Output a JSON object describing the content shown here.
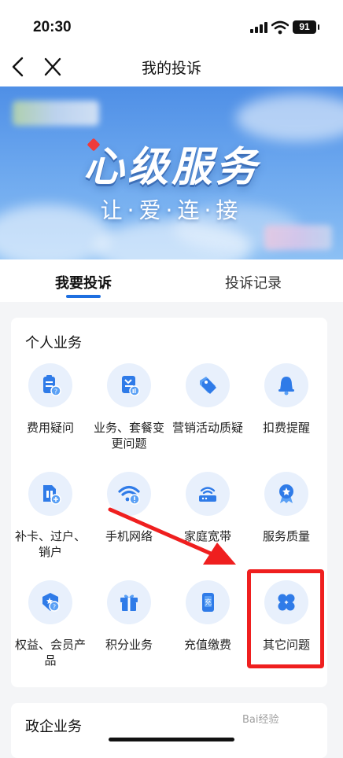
{
  "status_bar": {
    "time": "20:30",
    "battery": "91"
  },
  "nav": {
    "title": "我的投诉"
  },
  "banner": {
    "headline": "心级服务",
    "subline": "让·爱·连·接"
  },
  "tabs": [
    {
      "label": "我要投诉",
      "active": true
    },
    {
      "label": "投诉记录",
      "active": false
    }
  ],
  "personal": {
    "title": "个人业务",
    "items": [
      {
        "label": "费用疑问",
        "icon": "bill-question-icon"
      },
      {
        "label": "业务、套餐变更问题",
        "icon": "package-change-icon"
      },
      {
        "label": "营销活动质疑",
        "icon": "tag-icon"
      },
      {
        "label": "扣费提醒",
        "icon": "bell-icon"
      },
      {
        "label": "补卡、过户、销户",
        "icon": "sim-card-icon"
      },
      {
        "label": "手机网络",
        "icon": "wifi-alert-icon"
      },
      {
        "label": "家庭宽带",
        "icon": "router-icon"
      },
      {
        "label": "服务质量",
        "icon": "award-icon"
      },
      {
        "label": "权益、会员产品",
        "icon": "member-shield-icon"
      },
      {
        "label": "积分业务",
        "icon": "gift-icon"
      },
      {
        "label": "充值缴费",
        "icon": "recharge-phone-icon"
      },
      {
        "label": "其它问题",
        "icon": "four-petal-icon"
      }
    ]
  },
  "enterprise": {
    "title": "政企业务"
  },
  "watermark": "Bai经验"
}
